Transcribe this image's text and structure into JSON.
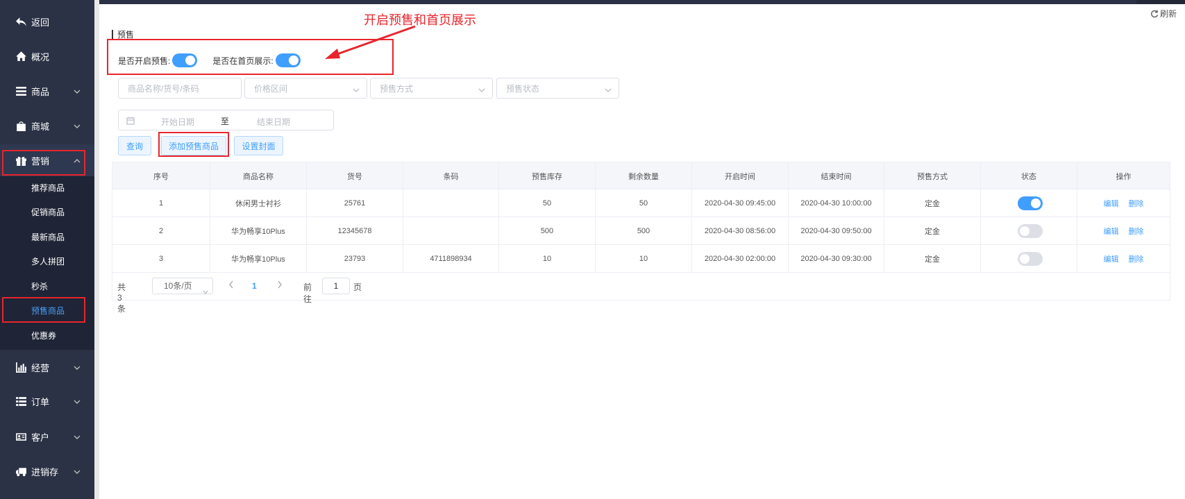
{
  "sidebar": {
    "items": [
      {
        "label": "返回",
        "icon": "back-arrow-icon"
      },
      {
        "label": "概况",
        "icon": "home-icon"
      },
      {
        "label": "商品",
        "icon": "menu-lines-icon"
      },
      {
        "label": "商城",
        "icon": "shopping-bag-icon"
      },
      {
        "label": "营销",
        "icon": "gift-icon"
      },
      {
        "label": "经营",
        "icon": "bar-chart-icon"
      },
      {
        "label": "订单",
        "icon": "list-icon"
      },
      {
        "label": "客户",
        "icon": "id-card-icon"
      },
      {
        "label": "进销存",
        "icon": "truck-icon"
      }
    ],
    "marketing_submenu": [
      "推荐商品",
      "促销商品",
      "最新商品",
      "多人拼团",
      "秒杀",
      "预售商品",
      "优惠券"
    ],
    "active_submenu": "预售商品"
  },
  "header": {
    "refresh_label": "刷新",
    "page_title": "预售"
  },
  "annotation": {
    "text": "开启预售和首页展示",
    "color": "#e8252d"
  },
  "toggles": {
    "presale_label": "是否开启预售:",
    "presale_on": true,
    "homepage_label": "是否在首页展示:",
    "homepage_on": true
  },
  "filters": {
    "search_placeholder": "商品名称/货号/条码",
    "price_placeholder": "价格区间",
    "method_placeholder": "预售方式",
    "status_placeholder": "预售状态",
    "start_date_placeholder": "开始日期",
    "date_separator": "至",
    "end_date_placeholder": "结束日期"
  },
  "buttons": {
    "query": "查询",
    "add_presale": "添加预售商品",
    "set_cover": "设置封面"
  },
  "table": {
    "columns": [
      "序号",
      "商品名称",
      "货号",
      "条码",
      "预售库存",
      "剩余数量",
      "开启时间",
      "结束时间",
      "预售方式",
      "状态",
      "操作"
    ],
    "rows": [
      {
        "index": "1",
        "name": "休闲男士衬衫",
        "sku": "25761",
        "barcode": "",
        "stock": "50",
        "remaining": "50",
        "start": "2020-04-30 09:45:00",
        "end": "2020-04-30 10:00:00",
        "method": "定金",
        "status_on": true
      },
      {
        "index": "2",
        "name": "华为畅享10Plus",
        "sku": "12345678",
        "barcode": "",
        "stock": "500",
        "remaining": "500",
        "start": "2020-04-30 08:56:00",
        "end": "2020-04-30 09:50:00",
        "method": "定金",
        "status_on": false
      },
      {
        "index": "3",
        "name": "华为畅享10Plus",
        "sku": "23793",
        "barcode": "4711898934",
        "stock": "10",
        "remaining": "10",
        "start": "2020-04-30 02:00:00",
        "end": "2020-04-30 09:30:00",
        "method": "定金",
        "status_on": false
      }
    ],
    "edit_label": "编辑",
    "delete_label": "删除"
  },
  "pagination": {
    "total": "共 3 条",
    "page_size": "10条/页",
    "current_page": "1",
    "goto_label": "前往",
    "goto_value": "1",
    "page_unit": "页"
  },
  "colors": {
    "sidebar_bg": "#2b3245",
    "accent": "#409eff",
    "annotation_red": "#e8252d"
  }
}
